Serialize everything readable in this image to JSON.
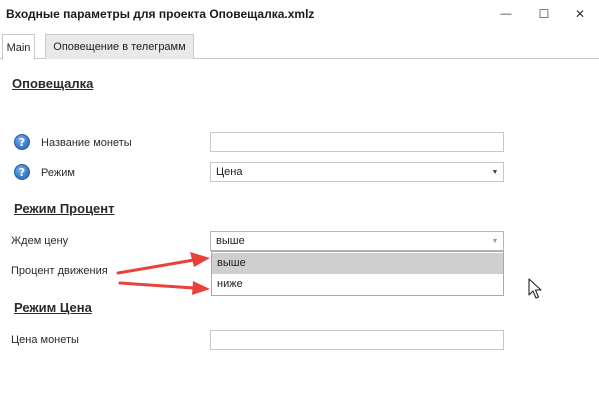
{
  "window": {
    "title": "Входные параметры для проекта Оповещалка.xmlz",
    "minimize_glyph": "—",
    "maximize_glyph": "☐",
    "close_glyph": "✕"
  },
  "tabs": [
    {
      "label": "Main",
      "active": true
    },
    {
      "label": "Оповещение в телеграмм",
      "active": false
    }
  ],
  "sections": {
    "main_title": "Оповещалка",
    "percent_title": "Режим Процент",
    "price_title": "Режим Цена"
  },
  "fields": {
    "coin_name": {
      "label": "Название монеты",
      "value": ""
    },
    "mode": {
      "label": "Режим",
      "value": "Цена"
    },
    "wait_price": {
      "label": "Ждем цену",
      "value": "выше"
    },
    "move_percent": {
      "label": "Процент  движения"
    },
    "coin_price": {
      "label": "Цена монеты",
      "value": ""
    }
  },
  "dropdown": {
    "options": [
      "выше",
      "ниже"
    ],
    "selected": "выше"
  },
  "icons": {
    "help": "help-icon",
    "help_glyph": "?",
    "combo_arrow": "▼",
    "cursor": "mouse-cursor-icon"
  },
  "colors": {
    "annotation_arrow": "#e8423a",
    "selected_item_bg": "#cfcfcf",
    "help_icon_blue": "#3b7fd0"
  }
}
